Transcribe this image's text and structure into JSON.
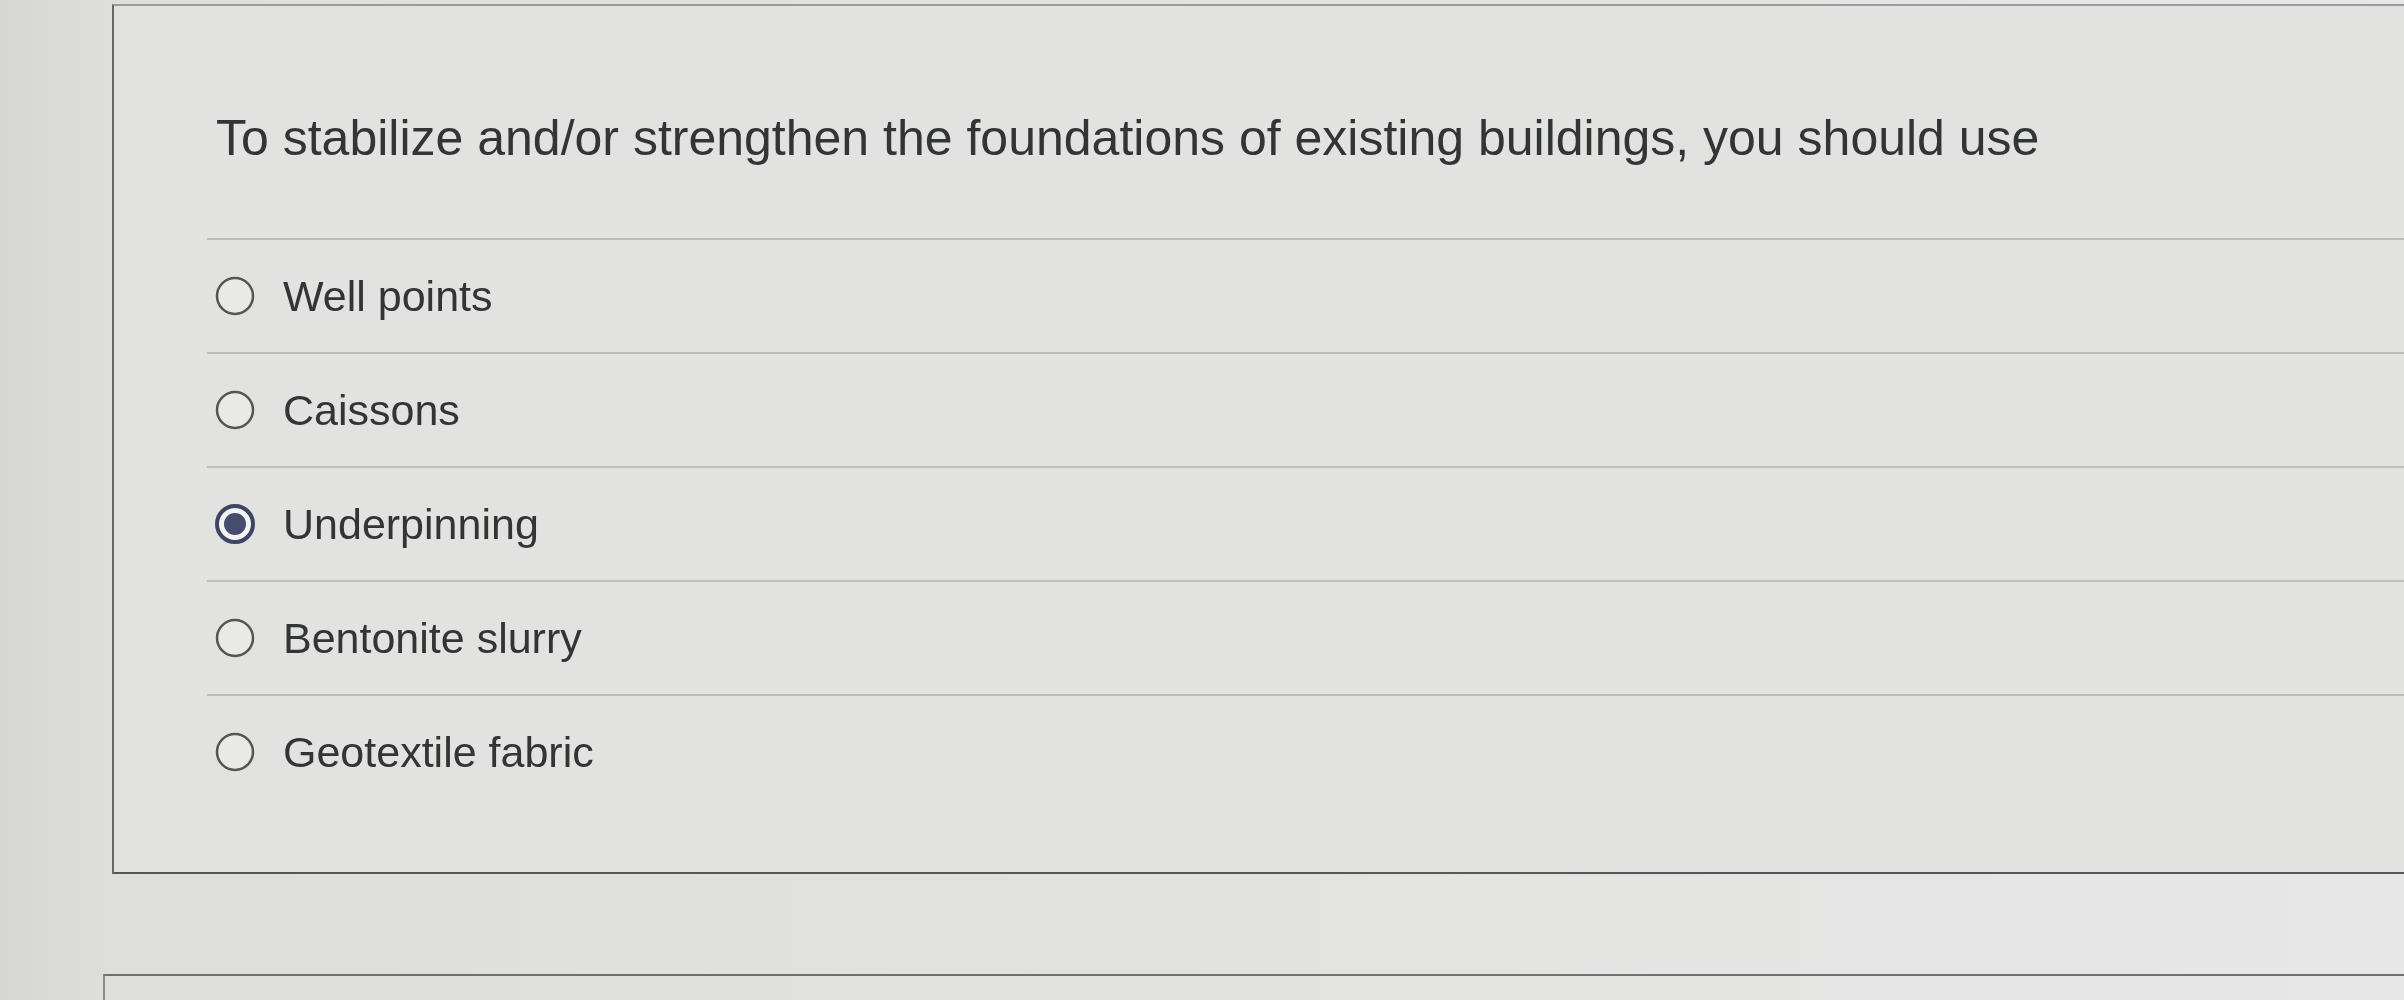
{
  "question": {
    "text": "To stabilize and/or strengthen the foundations of existing buildings, you should use"
  },
  "options": [
    {
      "label": "Well points",
      "selected": false
    },
    {
      "label": "Caissons",
      "selected": false
    },
    {
      "label": "Underpinning",
      "selected": true
    },
    {
      "label": "Bentonite slurry",
      "selected": false
    },
    {
      "label": "Geotextile fabric",
      "selected": false
    }
  ]
}
